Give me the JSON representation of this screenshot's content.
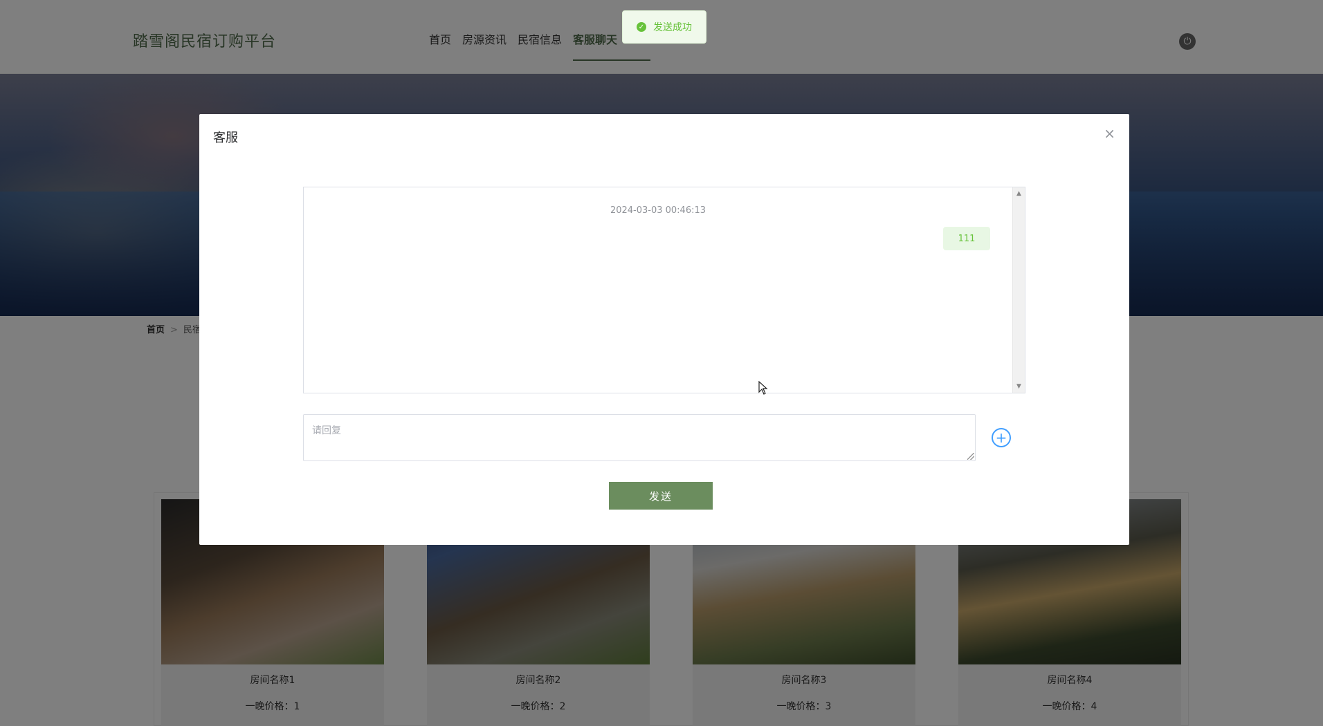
{
  "header": {
    "brand": "踏雪阁民宿订购平台",
    "nav": [
      "首页",
      "房源资讯",
      "民宿信息",
      "客服聊天"
    ]
  },
  "breadcrumb": {
    "home": "首页",
    "sep": ">",
    "current": "民宿"
  },
  "rooms": [
    {
      "name": "房间名称1",
      "price": "一晚价格：1"
    },
    {
      "name": "房间名称2",
      "price": "一晚价格：2"
    },
    {
      "name": "房间名称3",
      "price": "一晚价格：3"
    },
    {
      "name": "房间名称4",
      "price": "一晚价格：4"
    }
  ],
  "dialog": {
    "title": "客服",
    "close": "×",
    "chat": {
      "timestamp": "2024-03-03 00:46:13",
      "message": "111"
    },
    "reply_placeholder": "请回复",
    "plus": "+",
    "send_label": "发送"
  },
  "toast": {
    "text": "发送成功"
  },
  "colors": {
    "brand": "#4f6b4a",
    "send": "#6b8d5e",
    "success": "#67c23a",
    "link": "#409eff"
  }
}
